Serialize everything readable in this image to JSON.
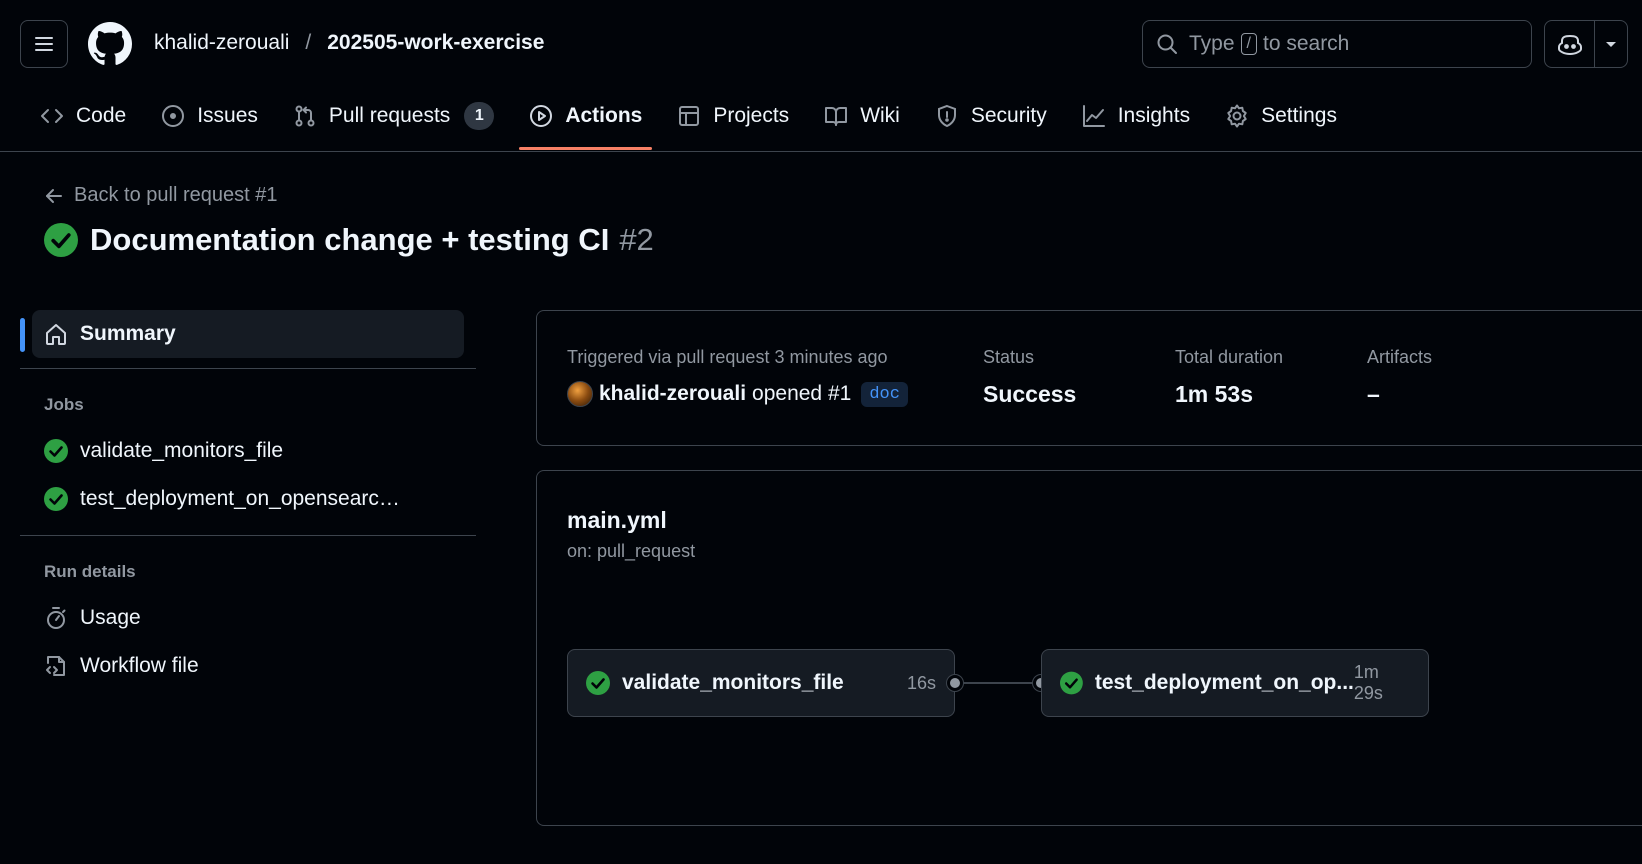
{
  "header": {
    "owner": "khalid-zerouali",
    "separator": "/",
    "repo": "202505-work-exercise",
    "search": {
      "prefix": "Type",
      "key": "/",
      "suffix": "to search"
    }
  },
  "tabs": [
    {
      "label": "Code",
      "icon": "code-icon"
    },
    {
      "label": "Issues",
      "icon": "issue-icon"
    },
    {
      "label": "Pull requests",
      "icon": "pull-request-icon",
      "count": "1"
    },
    {
      "label": "Actions",
      "icon": "play-icon",
      "active": true
    },
    {
      "label": "Projects",
      "icon": "table-icon"
    },
    {
      "label": "Wiki",
      "icon": "book-icon"
    },
    {
      "label": "Security",
      "icon": "shield-icon"
    },
    {
      "label": "Insights",
      "icon": "graph-icon"
    },
    {
      "label": "Settings",
      "icon": "gear-icon"
    }
  ],
  "run": {
    "back_label": "Back to pull request #1",
    "title": "Documentation change + testing CI",
    "number": "#2"
  },
  "sidebar": {
    "summary_label": "Summary",
    "jobs_heading": "Jobs",
    "jobs": [
      {
        "label": "validate_monitors_file"
      },
      {
        "label": "test_deployment_on_opensearch_..."
      }
    ],
    "run_details_heading": "Run details",
    "details": [
      {
        "label": "Usage"
      },
      {
        "label": "Workflow file"
      }
    ]
  },
  "summary": {
    "trigger_label": "Triggered via pull request 3 minutes ago",
    "actor": "khalid-zerouali",
    "action": "opened #1",
    "branch": "doc",
    "status_label": "Status",
    "status_value": "Success",
    "duration_label": "Total duration",
    "duration_value": "1m 53s",
    "artifacts_label": "Artifacts",
    "artifacts_value": "–"
  },
  "workflow": {
    "name": "main.yml",
    "trigger": "on: pull_request",
    "jobs": [
      {
        "name": "validate_monitors_file",
        "duration": "16s"
      },
      {
        "name": "test_deployment_on_op...",
        "duration": "1m 29s"
      }
    ]
  },
  "colors": {
    "success": "#2ea043",
    "accent": "#4493f8",
    "active_tab_underline": "#f78166"
  }
}
